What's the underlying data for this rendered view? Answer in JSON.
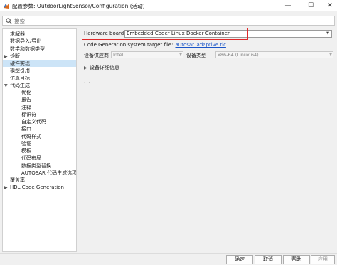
{
  "window": {
    "title": "配置参数: OutdoorLightSensor/Configuration (活动)",
    "minimize_glyph": "—",
    "maximize_glyph": "☐",
    "close_glyph": "✕"
  },
  "search": {
    "placeholder": "搜索"
  },
  "tree": {
    "items": [
      {
        "label": "求解器",
        "indent": 0,
        "arrow": ""
      },
      {
        "label": "数据导入/导出",
        "indent": 0,
        "arrow": ""
      },
      {
        "label": "数学和数据类型",
        "indent": 0,
        "arrow": ""
      },
      {
        "label": "诊断",
        "indent": 0,
        "arrow": "▶"
      },
      {
        "label": "硬件实现",
        "indent": 0,
        "arrow": "",
        "selected": true
      },
      {
        "label": "模型引用",
        "indent": 0,
        "arrow": ""
      },
      {
        "label": "仿真目标",
        "indent": 0,
        "arrow": ""
      },
      {
        "label": "代码生成",
        "indent": 0,
        "arrow": "▼"
      },
      {
        "label": "优化",
        "indent": 1,
        "arrow": ""
      },
      {
        "label": "报告",
        "indent": 1,
        "arrow": ""
      },
      {
        "label": "注释",
        "indent": 1,
        "arrow": ""
      },
      {
        "label": "标识符",
        "indent": 1,
        "arrow": ""
      },
      {
        "label": "自定义代码",
        "indent": 1,
        "arrow": ""
      },
      {
        "label": "接口",
        "indent": 1,
        "arrow": ""
      },
      {
        "label": "代码样式",
        "indent": 1,
        "arrow": ""
      },
      {
        "label": "验证",
        "indent": 1,
        "arrow": ""
      },
      {
        "label": "模板",
        "indent": 1,
        "arrow": ""
      },
      {
        "label": "代码布局",
        "indent": 1,
        "arrow": ""
      },
      {
        "label": "数据类型替换",
        "indent": 1,
        "arrow": ""
      },
      {
        "label": "AUTOSAR 代码生成选项",
        "indent": 1,
        "arrow": ""
      },
      {
        "label": "覆盖率",
        "indent": 0,
        "arrow": ""
      },
      {
        "label": "HDL Code Generation",
        "indent": 0,
        "arrow": "▶"
      }
    ]
  },
  "hardware": {
    "label": "Hardware board:",
    "value": "Embedded Coder Linux Docker Container"
  },
  "codegen_target": {
    "label": "Code Generation system target file:",
    "link": "autosar_adaptive.tlc"
  },
  "device": {
    "vendor_label": "设备供应商",
    "vendor_value": "Intel",
    "type_label": "设备类型",
    "type_value": "x86-64 (Linux 64)"
  },
  "details": {
    "label": "设备详细信息",
    "arrow": "▶",
    "dots": "..."
  },
  "buttons": {
    "ok": "确定",
    "cancel": "取消",
    "help": "帮助",
    "apply": "应用"
  },
  "colors": {
    "highlight": "#e0292a",
    "selection": "#cce4f7",
    "link": "#1a55c8"
  }
}
